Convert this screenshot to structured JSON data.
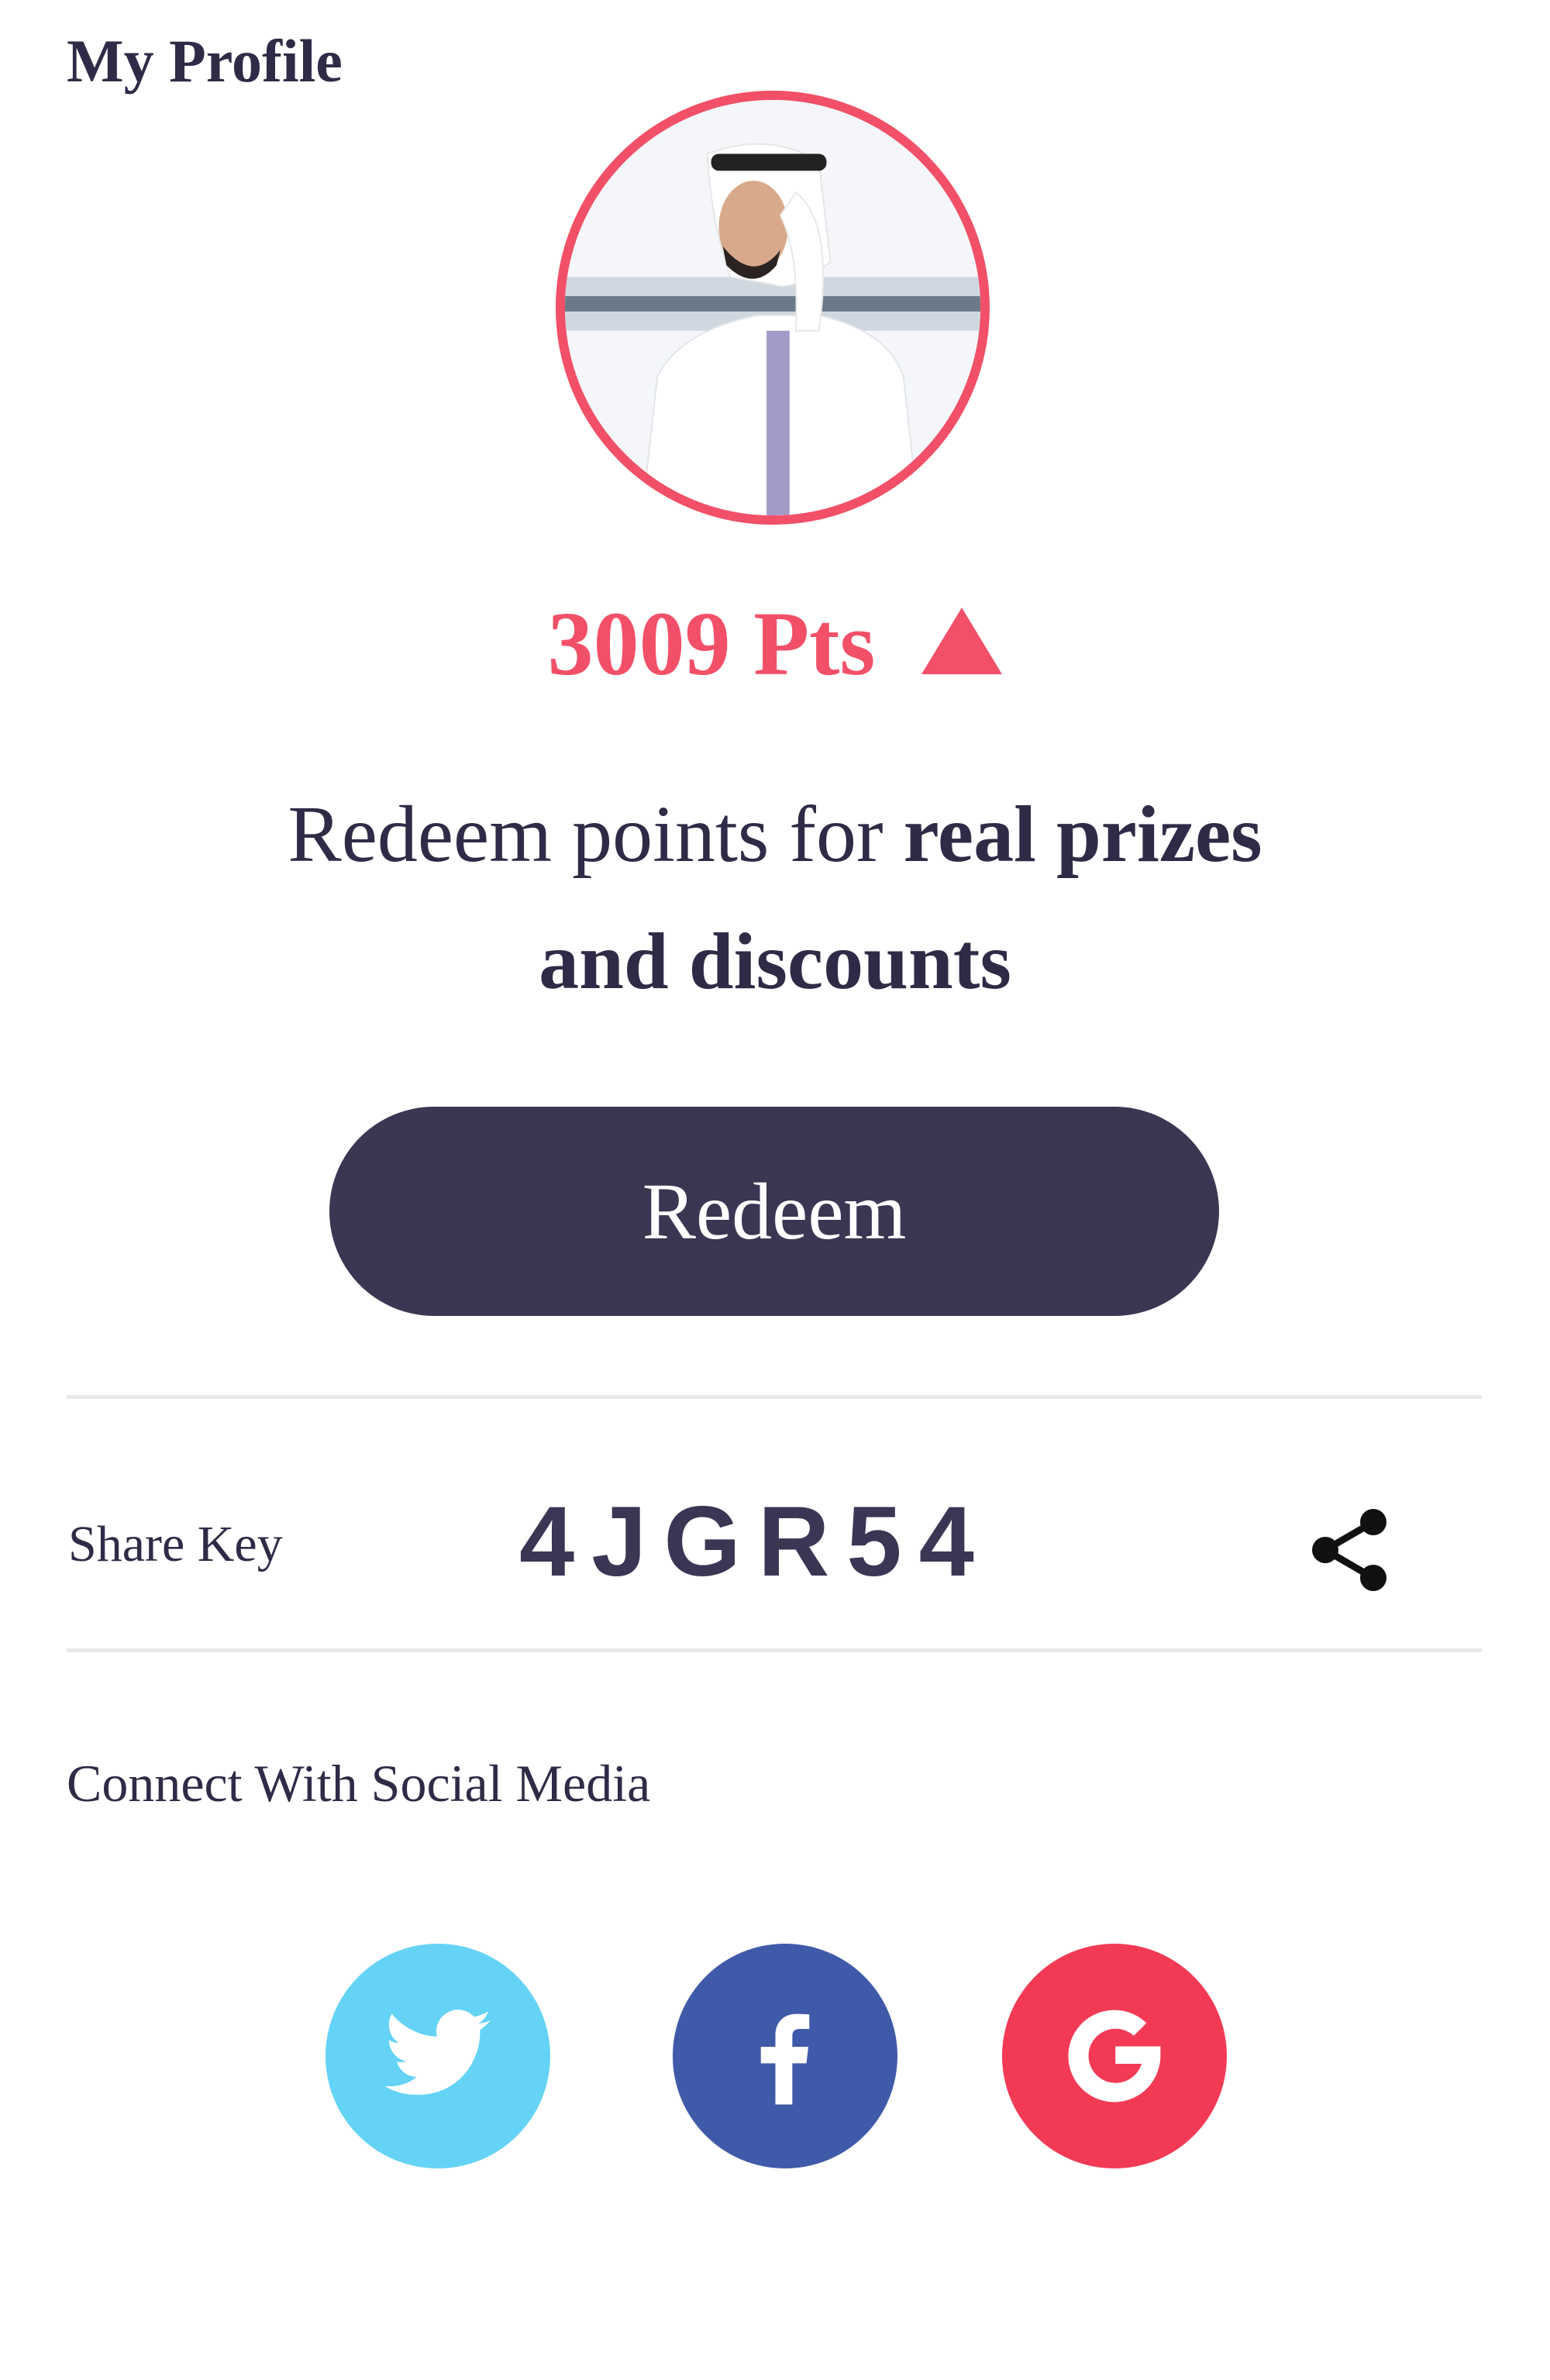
{
  "header": {
    "title": "My Profile"
  },
  "profile": {
    "avatar_alt": "profile-photo",
    "points": "3009 Pts",
    "points_trend_icon": "triangle-up-icon",
    "tagline_plain": "Redeem points for ",
    "tagline_bold_1": "real prizes",
    "tagline_bold_2": "and discounts"
  },
  "redeem": {
    "label": "Redeem"
  },
  "share": {
    "label": "Share Key",
    "key": "4JGR54",
    "icon": "share-icon"
  },
  "social": {
    "label": "Connect With Social Media",
    "buttons": [
      {
        "name": "twitter",
        "icon": "twitter-icon",
        "color": "#65d3f5"
      },
      {
        "name": "facebook",
        "icon": "facebook-icon",
        "color": "#3f5aa8"
      },
      {
        "name": "google",
        "icon": "google-icon",
        "color": "#f23a55"
      }
    ]
  },
  "colors": {
    "accent": "#f25068",
    "primary_dark": "#3c3653",
    "divider": "#e8e8ea"
  }
}
